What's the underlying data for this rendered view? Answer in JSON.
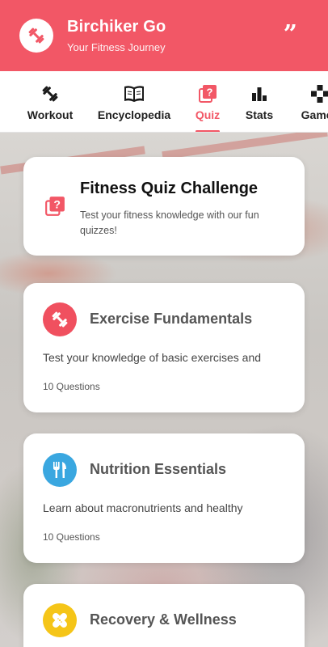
{
  "app": {
    "name": "Birchiker Go",
    "tagline": "Your Fitness Journey",
    "accent_color": "#f25766",
    "logo_icon": "dumbbell-icon",
    "header_action_icon": "quote-icon"
  },
  "tabs": [
    {
      "label": "Workout",
      "icon": "dumbbell-icon",
      "active": false
    },
    {
      "label": "Encyclopedia",
      "icon": "book-icon",
      "active": false
    },
    {
      "label": "Quiz",
      "icon": "quiz-icon",
      "active": true
    },
    {
      "label": "Stats",
      "icon": "bar-chart-icon",
      "active": false
    },
    {
      "label": "Games",
      "icon": "gamepad-icon",
      "active": false
    }
  ],
  "intro": {
    "title": "Fitness Quiz Challenge",
    "description": "Test your fitness knowledge with our fun quizzes!",
    "icon": "quiz-icon"
  },
  "quizzes": [
    {
      "title": "Exercise Fundamentals",
      "description": "Test your knowledge of basic exercises and",
      "count": "10 Questions",
      "icon": "dumbbell-icon",
      "color": "#f0505f"
    },
    {
      "title": "Nutrition Essentials",
      "description": "Learn about macronutrients and healthy",
      "count": "10 Questions",
      "icon": "utensils-icon",
      "color": "#3aa7e0"
    },
    {
      "title": "Recovery & Wellness",
      "description": "",
      "count": "",
      "icon": "bandage-icon",
      "color": "#f5c518"
    }
  ]
}
